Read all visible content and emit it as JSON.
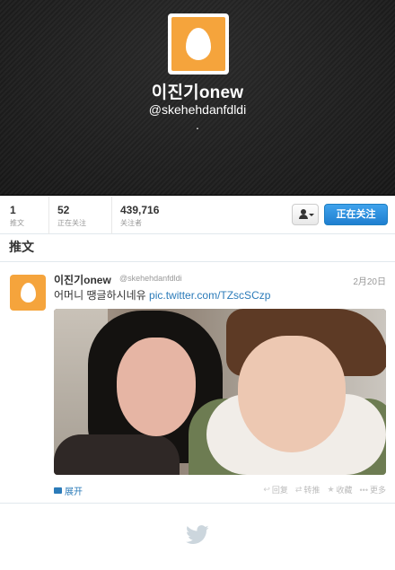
{
  "profile": {
    "name": "이진기onew",
    "handle": "@skehehdanfdldi",
    "bio": "."
  },
  "stats": [
    {
      "value": "1",
      "label": "推文"
    },
    {
      "value": "52",
      "label": "正在关注"
    },
    {
      "value": "439,716",
      "label": "关注者"
    }
  ],
  "buttons": {
    "user_menu_icon": "user-icon",
    "following_label": "正在关注"
  },
  "timeline": {
    "heading": "推文"
  },
  "tweet": {
    "name": "이진기onew",
    "handle": "@skehehdanfdldi",
    "time": "2月20日",
    "text": "어머니 땡글하시네유",
    "link": "pic.twitter.com/TZscSCzp",
    "expand_label": "展开",
    "actions": {
      "reply": "回复",
      "retweet": "转推",
      "favorite": "收藏",
      "more": "更多"
    }
  },
  "colors": {
    "accent": "#2b7bb9",
    "avatar_bg": "#f5a43c",
    "follow_button": "#2b8fe0"
  }
}
